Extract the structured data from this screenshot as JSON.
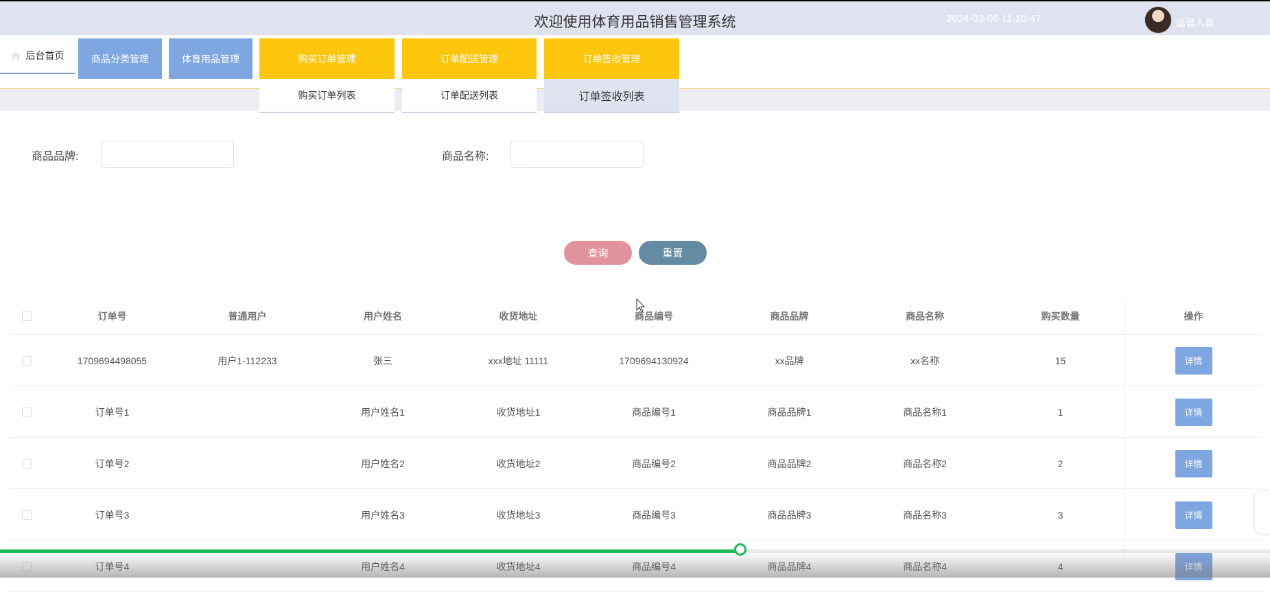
{
  "header": {
    "title": "欢迎使用体育用品销售管理系统",
    "datetime": "2024-03-06 11:10:47",
    "user_role": "运营人员"
  },
  "nav": {
    "home": "后台首页",
    "items": [
      {
        "label": "商品分类管理"
      },
      {
        "label": "体育用品管理"
      },
      {
        "label": "购买订单管理"
      },
      {
        "label": "订单配送管理"
      },
      {
        "label": "订单签收管理"
      }
    ],
    "sub_items": [
      {
        "label": "购买订单列表"
      },
      {
        "label": "订单配送列表"
      },
      {
        "label": "订单签收列表"
      }
    ]
  },
  "search": {
    "brand_label": "商品品牌:",
    "brand_value": "",
    "name_label": "商品名称:",
    "name_value": "",
    "search_button": "查询",
    "reset_button": "重置"
  },
  "table": {
    "headers": [
      "订单号",
      "普通用户",
      "用户姓名",
      "收货地址",
      "商品编号",
      "商品品牌",
      "商品名称",
      "购买数量",
      "操作"
    ],
    "detail_label": "详情",
    "rows": [
      [
        "1709694498055",
        "用户1-112233",
        "张三",
        "xxx地址 11111",
        "1709694130924",
        "xx品牌",
        "xx名称",
        "15"
      ],
      [
        "订单号1",
        "",
        "用户姓名1",
        "收货地址1",
        "商品编号1",
        "商品品牌1",
        "商品名称1",
        "1"
      ],
      [
        "订单号2",
        "",
        "用户姓名2",
        "收货地址2",
        "商品编号2",
        "商品品牌2",
        "商品名称2",
        "2"
      ],
      [
        "订单号3",
        "",
        "用户姓名3",
        "收货地址3",
        "商品编号3",
        "商品品牌3",
        "商品名称3",
        "3"
      ],
      [
        "订单号4",
        "",
        "用户姓名4",
        "收货地址4",
        "商品编号4",
        "商品品牌4",
        "商品名称4",
        "4"
      ]
    ]
  },
  "player": {
    "progress": 0.583
  },
  "colors": {
    "accent_blue": "#7ea6e0",
    "accent_yellow": "#ffc60e",
    "search_button": "#e0939c",
    "reset_button": "#648ba1",
    "progress": "#1db954"
  }
}
